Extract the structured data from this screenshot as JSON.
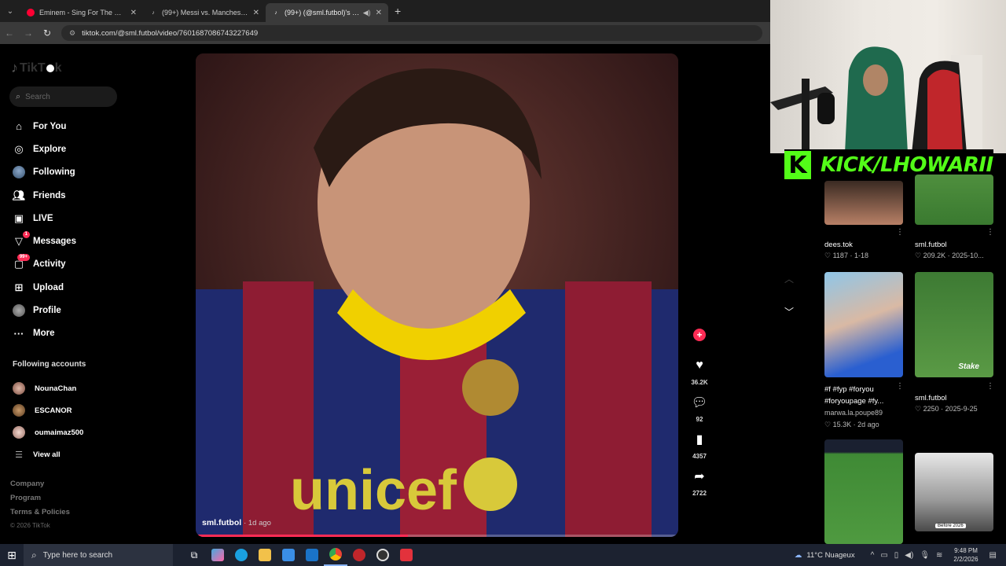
{
  "browser": {
    "tabs": [
      {
        "title": "Eminem - Sing For The Moment",
        "icon": "youtube-icon"
      },
      {
        "title": "(99+) Messi vs. Manchester City",
        "icon": "tiktok-icon"
      },
      {
        "title": "(99+) (@sml.futbol)'s video",
        "icon": "tiktok-icon"
      }
    ],
    "url": "tiktok.com/@sml.futbol/video/7601687086743227649"
  },
  "sidebar": {
    "logo": "TikTok",
    "search_placeholder": "Search",
    "nav": [
      {
        "label": "For You",
        "icon": "home-icon"
      },
      {
        "label": "Explore",
        "icon": "compass-icon"
      },
      {
        "label": "Following",
        "icon": "avatar-icon"
      },
      {
        "label": "Friends",
        "icon": "friends-icon"
      },
      {
        "label": "LIVE",
        "icon": "live-icon"
      },
      {
        "label": "Messages",
        "icon": "messages-icon",
        "badge": "1"
      },
      {
        "label": "Activity",
        "icon": "activity-icon",
        "badge": "99+"
      },
      {
        "label": "Upload",
        "icon": "upload-icon"
      },
      {
        "label": "Profile",
        "icon": "profile-icon"
      },
      {
        "label": "More",
        "icon": "more-icon"
      }
    ],
    "following_title": "Following accounts",
    "accounts": [
      "NounaChan",
      "ESCANOR",
      "oumaimaz500"
    ],
    "view_all": "View all",
    "footer": [
      "Company",
      "Program",
      "Terms & Policies"
    ],
    "copyright": "© 2026 TikTok"
  },
  "video": {
    "author": "sml.futbol",
    "ago": "· 1d ago",
    "progress": 0.44
  },
  "actions": {
    "likes": "36.2K",
    "comments": "92",
    "saves": "4357",
    "shares": "2722"
  },
  "overlay": {
    "kick_text": "KICK/LHOWARII",
    "kick_logo": "K"
  },
  "recommended": [
    {
      "title": "dees.tok",
      "likes": "1187",
      "date": "1-18"
    },
    {
      "title": "sml.futbol",
      "likes": "209.2K",
      "date": "2025-10..."
    },
    {
      "title": "#f #fyp #foryou #foryoupage #fy...",
      "author": "marwa.la.poupe89",
      "likes": "15.3K",
      "date": "2d ago"
    },
    {
      "title": "sml.futbol",
      "likes": "2250",
      "date": "2025-9-25"
    }
  ],
  "thumb_text": {
    "stake": "Stake",
    "before": "Before 2026"
  },
  "taskbar": {
    "search_placeholder": "Type here to search",
    "weather": "11°C  Nuageux",
    "time": "9:48 PM",
    "date": "2/2/2026"
  }
}
